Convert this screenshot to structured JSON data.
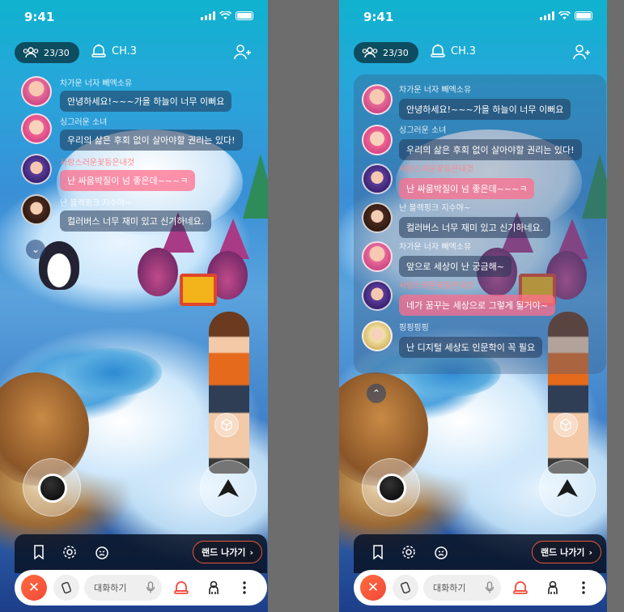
{
  "colors": {
    "accent": "#f24a3a",
    "bubble_pink": "#ff6e8c",
    "panel_dark": "#0a1428"
  },
  "status_bar": {
    "time": "9:41"
  },
  "top_bar": {
    "participant_count": "23/30",
    "channel": "CH.3",
    "people_icon": "people-icon",
    "channel_icon": "bell-channel-icon",
    "add_friend_icon": "add-friend-icon"
  },
  "left_chat": {
    "messages": [
      {
        "nickname": "차가운 너자 빼엑소유",
        "text": "안녕하세요!~~~가을 하늘이 너무 이뻐요",
        "highlight": false,
        "nick_red": false
      },
      {
        "nickname": "싱그러운 소녀",
        "text": "우리의 삶은 후회 없이 살아야할 권리는 있다!",
        "highlight": false,
        "nick_red": false
      },
      {
        "nickname": "사랑스러운꽃등은내것",
        "text": "난 싸움박질이 넘 좋은데~~~ㅋ",
        "highlight": true,
        "nick_red": true
      },
      {
        "nickname": "난 블랙핑크 지수야~",
        "text": "컬러버스 너무 재미 있고 신기하네요.",
        "highlight": false,
        "nick_red": false
      }
    ],
    "collapse_icon": "chevron-down-icon"
  },
  "right_chat": {
    "messages": [
      {
        "nickname": "차가운 너자 빼엑소유",
        "text": "안녕하세요!~~~가을 하늘이 너무 이뻐요",
        "highlight": false,
        "nick_red": false
      },
      {
        "nickname": "싱그러운 소녀",
        "text": "우리의 삶은 후회 없이 살아야할 권리는 있다!",
        "highlight": false,
        "nick_red": false
      },
      {
        "nickname": "사랑스러운꽃등은내것",
        "text": "난 싸움박질이 넘 좋은데~~~ㅋ",
        "highlight": true,
        "nick_red": true
      },
      {
        "nickname": "난 블랙핑크 지수야~",
        "text": "컬러버스 너무 재미 있고 신기하네요.",
        "highlight": false,
        "nick_red": false
      },
      {
        "nickname": "차가운 너자 빼엑소유",
        "text": "앞으로 세상이 난 궁금해~",
        "highlight": false,
        "nick_red": false
      },
      {
        "nickname": "사랑스러운꽃등은내것",
        "text": "네가 꿈꾸는 세상으로 그렇게 될거야~",
        "highlight": true,
        "nick_red": true
      },
      {
        "nickname": "핑핑핑핑",
        "text": "난 디지털 세상도 인문학이 꼭 필요",
        "highlight": false,
        "nick_red": false
      }
    ],
    "expand_icon": "chevron-up-icon"
  },
  "controls": {
    "cube_icon": "cube-icon",
    "joystick": "joystick-control",
    "jump_icon": "jump-arrow-icon"
  },
  "toolbar": {
    "bookmark_icon": "bookmark-icon",
    "settings_icon": "gear-icon",
    "emote_icon": "emote-icon",
    "leave_label": "랜드 나가기",
    "leave_chevron": "›"
  },
  "bottom_bar": {
    "close_icon": "close-icon",
    "rotate_icon": "rotate-screen-icon",
    "chat_placeholder": "대화하기",
    "mic_icon": "mic-icon",
    "bell_icon": "bell-icon",
    "avatar_icon": "avatar-person-icon",
    "more_icon": "more-vertical-icon"
  }
}
